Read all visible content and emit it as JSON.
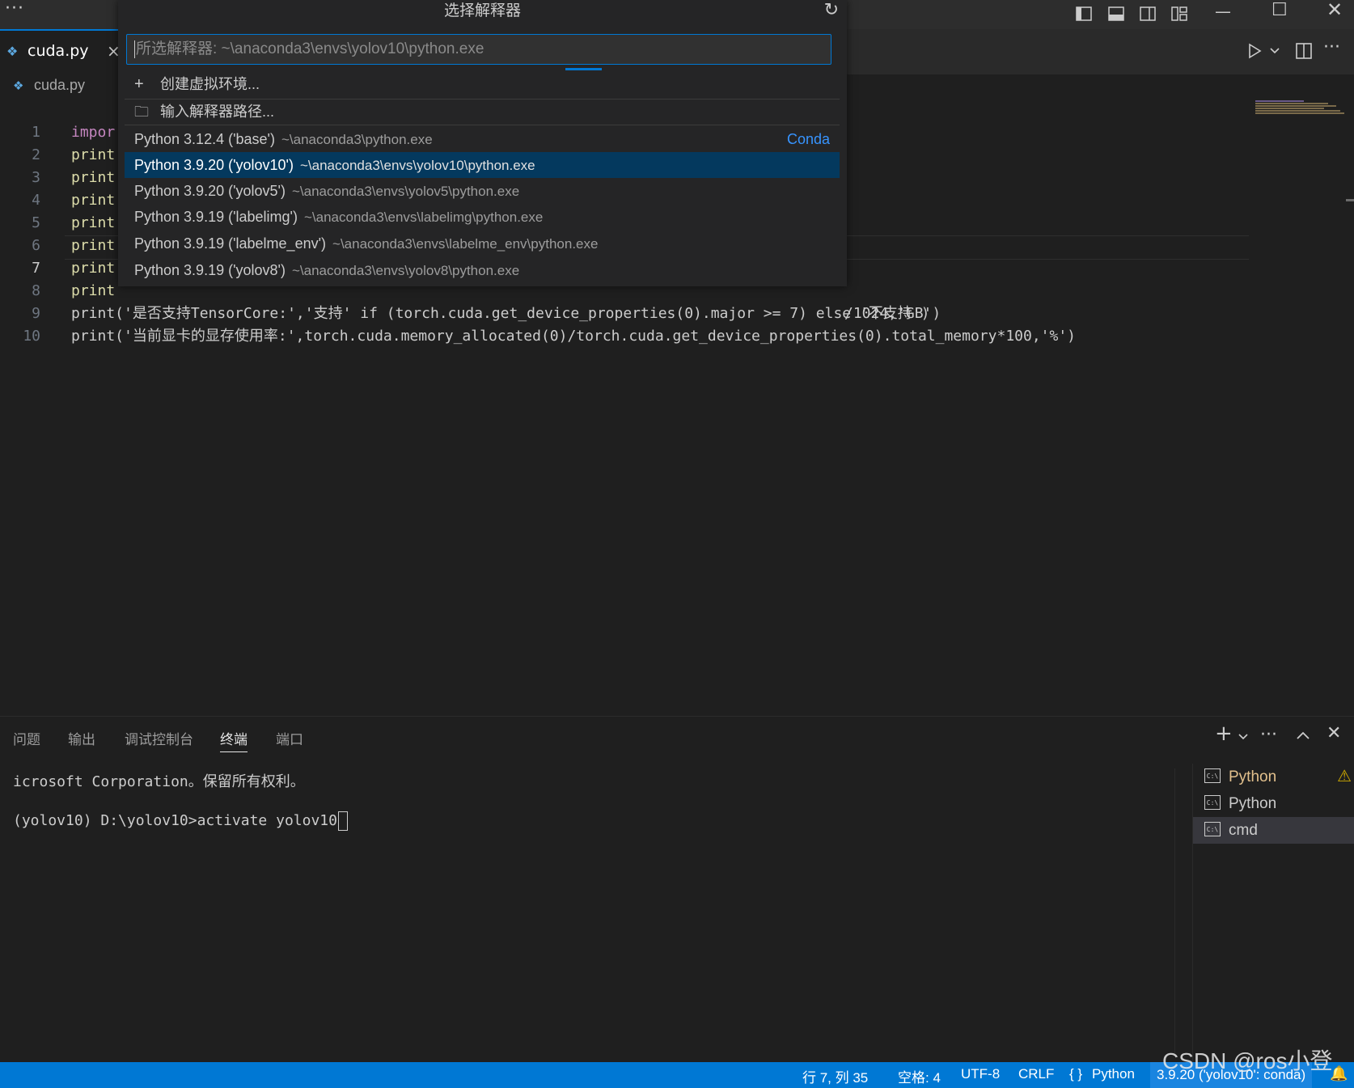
{
  "titlebar": {
    "more": "···"
  },
  "tabs": [
    {
      "label": "cuda.py",
      "close": "×"
    }
  ],
  "breadcrumb": {
    "file": "cuda.py"
  },
  "editor": {
    "lines": [
      {
        "n": "1",
        "text": "impor"
      },
      {
        "n": "2",
        "text": "print"
      },
      {
        "n": "3",
        "text": "print"
      },
      {
        "n": "4",
        "text": "print"
      },
      {
        "n": "5",
        "text": "print"
      },
      {
        "n": "6",
        "text": "print"
      },
      {
        "n": "7",
        "text": "print"
      },
      {
        "n": "8",
        "text": "print"
      },
      {
        "n": "9",
        "text": "print('是否支持TensorCore:','支持' if (torch.cuda.get_device_properties(0).major >= 7) else '不支持')"
      },
      {
        "n": "10",
        "text": "print('当前显卡的显存使用率:',torch.cuda.memory_allocated(0)/torch.cuda.get_device_properties(0).total_memory*100,'%')"
      }
    ],
    "line8_tail": "/1024,'GB')"
  },
  "quickpick": {
    "title": "选择解释器",
    "input_placeholder": "所选解释器: ~\\anaconda3\\envs\\yolov10\\python.exe",
    "actions": [
      {
        "icon": "+",
        "label": "创建虚拟环境..."
      },
      {
        "icon": "🗀",
        "label": "输入解释器路径..."
      }
    ],
    "items": [
      {
        "label": "Python 3.12.4 ('base')",
        "path": "~\\anaconda3\\python.exe",
        "tag": "Conda"
      },
      {
        "label": "Python 3.9.20 ('yolov10')",
        "path": "~\\anaconda3\\envs\\yolov10\\python.exe"
      },
      {
        "label": "Python 3.9.20 ('yolov5')",
        "path": "~\\anaconda3\\envs\\yolov5\\python.exe"
      },
      {
        "label": "Python 3.9.19 ('labelimg')",
        "path": "~\\anaconda3\\envs\\labelimg\\python.exe"
      },
      {
        "label": "Python 3.9.19 ('labelme_env')",
        "path": "~\\anaconda3\\envs\\labelme_env\\python.exe"
      },
      {
        "label": "Python 3.9.19 ('yolov8')",
        "path": "~\\anaconda3\\envs\\yolov8\\python.exe"
      }
    ]
  },
  "panel": {
    "tabs": [
      "问题",
      "输出",
      "调试控制台",
      "终端",
      "端口"
    ],
    "active_tab": "终端",
    "terminal_lines": [
      "icrosoft Corporation。保留所有权利。",
      "(yolov10) D:\\yolov10>activate yolov10"
    ],
    "terminals": [
      {
        "label": "Python",
        "warning": true
      },
      {
        "label": "Python",
        "warning": false
      },
      {
        "label": "cmd",
        "warning": false
      }
    ]
  },
  "statusbar": {
    "position": "行 7, 列 35",
    "spaces": "空格: 4",
    "encoding": "UTF-8",
    "eol": "CRLF",
    "language": "Python",
    "interpreter": "3.9.20 ('yolov10': conda)"
  },
  "watermark": "CSDN @ros小登",
  "colors": {
    "accent": "#0078d4",
    "selection": "#04395e",
    "warning": "#cca700"
  }
}
